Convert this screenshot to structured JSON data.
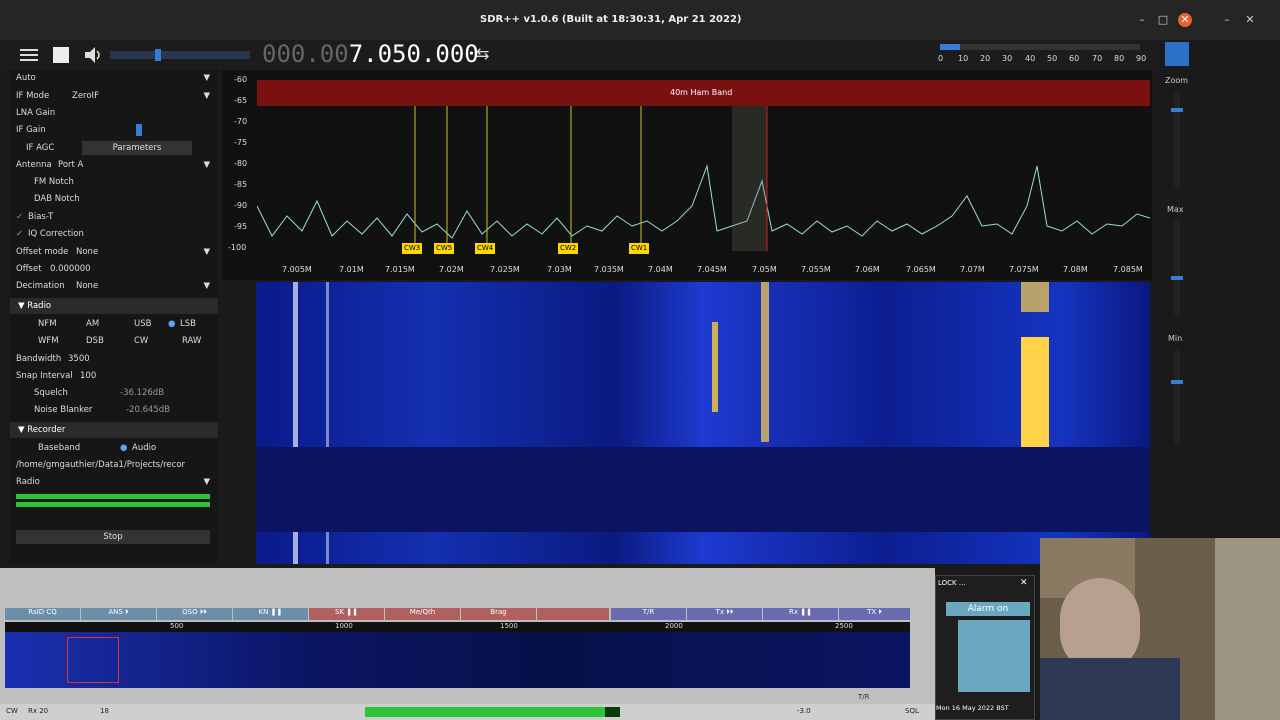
{
  "window": {
    "title": "SDR++ v1.0.6 (Built at 18:30:31, Apr 21 2022)",
    "min": "–",
    "max": "□",
    "close": "✕"
  },
  "toolbar": {
    "freq_dim": "000.00",
    "freq_main": "7.050.000",
    "swap": "⇆"
  },
  "snr_scale": [
    "0",
    "10",
    "20",
    "30",
    "40",
    "50",
    "60",
    "70",
    "80",
    "90"
  ],
  "sidebar": {
    "auto": "Auto",
    "if_mode_label": "IF Mode",
    "if_mode_value": "ZeroIF",
    "lna_gain": "LNA Gain",
    "if_gain": "IF Gain",
    "if_agc": "IF AGC",
    "parameters": "Parameters",
    "antenna_label": "Antenna",
    "antenna_value": "Port A",
    "fm_notch": "FM Notch",
    "dab_notch": "DAB Notch",
    "bias_t": "Bias-T",
    "iq_correction": "IQ Correction",
    "offset_mode_label": "Offset mode",
    "offset_mode_value": "None",
    "offset_label": "Offset",
    "offset_value": "0.000000",
    "decimation_label": "Decimation",
    "decimation_value": "None",
    "radio": "Radio",
    "modes": [
      "NFM",
      "AM",
      "USB",
      "LSB",
      "WFM",
      "DSB",
      "CW",
      "RAW"
    ],
    "bandwidth_label": "Bandwidth",
    "bandwidth_value": "3500",
    "snap_label": "Snap Interval",
    "snap_value": "100",
    "squelch_label": "Squelch",
    "squelch_value": "-36.126dB",
    "noise_label": "Noise Blanker",
    "noise_value": "-20.645dB",
    "recorder": "Recorder",
    "baseband": "Baseband",
    "audio": "Audio",
    "path": "/home/gmgauthier/Data1/Projects/recor",
    "radio2": "Radio",
    "stop": "Stop"
  },
  "fft": {
    "band_label": "40m Ham Band",
    "y_labels": [
      "-60",
      "-65",
      "-70",
      "-75",
      "-80",
      "-85",
      "-90",
      "-95",
      "-100"
    ],
    "x_labels": [
      "7.005M",
      "7.01M",
      "7.015M",
      "7.02M",
      "7.025M",
      "7.03M",
      "7.035M",
      "7.04M",
      "7.045M",
      "7.05M",
      "7.055M",
      "7.06M",
      "7.065M",
      "7.07M",
      "7.075M",
      "7.08M",
      "7.085M"
    ],
    "tags": [
      "CW3",
      "CW5",
      "CW4",
      "CW2",
      "CW1"
    ]
  },
  "rightpanel": {
    "zoom": "Zoom",
    "max": "Max",
    "min": "Min"
  },
  "bottom": {
    "segments": [
      "RsID CQ",
      "ANS ⏵",
      "QSO ⏵⏵",
      "KN ❚❚",
      "SK ❚❚",
      "Me/Qth",
      "Brag",
      "",
      "T/R",
      "Tx ⏵⏵",
      "Rx ❚❚",
      "TX ⏵"
    ],
    "scale": [
      "500",
      "1000",
      "1500",
      "2000",
      "2500"
    ],
    "status_mode": "CW",
    "status_rx": "Rx 20",
    "status_val": "18",
    "status_tr": "T/R",
    "status_db": "-3.0",
    "status_sql": "SQL"
  },
  "clock": {
    "title": "LOCK ...",
    "alarm": "Alarm on",
    "date": "Mon 16 May 2022 BST"
  }
}
